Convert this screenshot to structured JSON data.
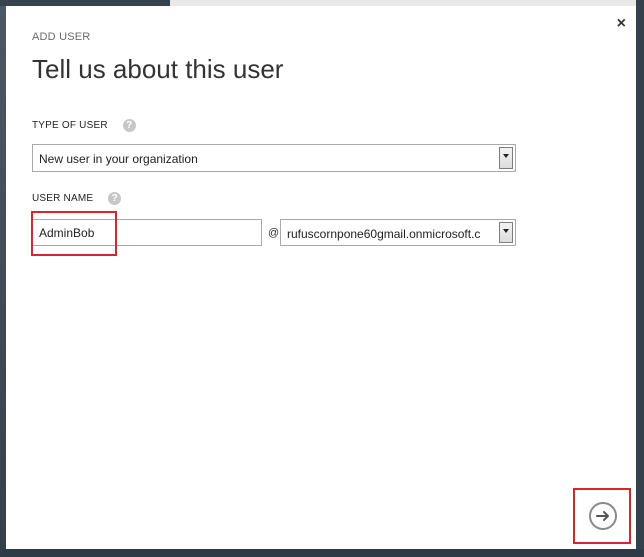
{
  "dialog": {
    "kicker": "ADD USER",
    "title": "Tell us about this user",
    "close_glyph": "×"
  },
  "type_of_user": {
    "label": "TYPE OF USER",
    "help_glyph": "?",
    "selected": "New user in your organization"
  },
  "user_name": {
    "label": "USER NAME",
    "help_glyph": "?",
    "value": "AdminBob",
    "at": "@",
    "domain": "rufuscornpone60gmail.onmicrosoft.c"
  },
  "icons": {
    "close": "close-icon",
    "help": "help-icon",
    "dropdown": "chevron-down-icon",
    "next": "arrow-right-icon"
  },
  "colors": {
    "highlight": "#d8262c",
    "backdrop": "#3c4a57",
    "dialog_bg": "#ffffff"
  }
}
